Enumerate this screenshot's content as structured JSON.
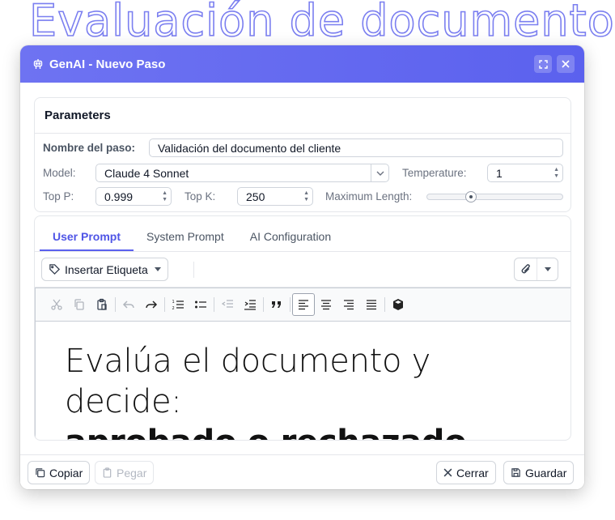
{
  "background": {
    "title": "Evaluación de documento"
  },
  "dialog": {
    "title": "GenAI - Nuevo Paso",
    "accent_color": "#5b61ee"
  },
  "parameters": {
    "heading": "Parameters",
    "step_name_label": "Nombre del paso:",
    "step_name_value": "Validación del documento del cliente",
    "model_label": "Model:",
    "model_value": "Claude 4 Sonnet",
    "temperature_label": "Temperature:",
    "temperature_value": "1",
    "top_p_label": "Top P:",
    "top_p_value": "0.999",
    "top_k_label": "Top K:",
    "top_k_value": "250",
    "max_length_label": "Maximum Length:",
    "max_length_fraction": 0.31
  },
  "tabs": [
    {
      "label": "User Prompt",
      "active": true
    },
    {
      "label": "System Prompt",
      "active": false
    },
    {
      "label": "AI Configuration",
      "active": false
    }
  ],
  "tagbar": {
    "insert_tag_label": "Insertar Etiqueta"
  },
  "editor": {
    "toolbar_icons": [
      "cut-icon",
      "copy-icon",
      "paste-icon",
      "undo-icon",
      "redo-icon",
      "ordered-list-icon",
      "bullet-list-icon",
      "outdent-icon",
      "indent-icon",
      "quote-icon",
      "align-left-icon",
      "align-center-icon",
      "align-right-icon",
      "justify-icon",
      "source-icon"
    ],
    "line1": "Evalúa el documento y decide:",
    "line2": "aprobado o rechazado si..."
  },
  "footer": {
    "copy_label": "Copiar",
    "paste_label": "Pegar",
    "close_label": "Cerrar",
    "save_label": "Guardar"
  }
}
